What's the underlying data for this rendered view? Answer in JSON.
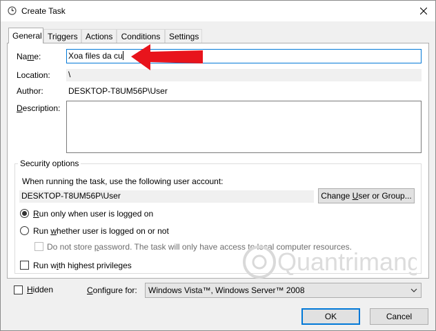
{
  "window": {
    "title": "Create Task"
  },
  "tabs": [
    "General",
    "Triggers",
    "Actions",
    "Conditions",
    "Settings"
  ],
  "fields": {
    "name_label_pre": "Na",
    "name_label_key": "m",
    "name_label_post": "e:",
    "name_value": "Xoa files da cu",
    "location_label": "Location:",
    "location_value": "\\",
    "author_label": "Author:",
    "author_value": "DESKTOP-T8UM56P\\User",
    "description_label_key": "D",
    "description_label_post": "escription:"
  },
  "security": {
    "title": "Security options",
    "account_prompt": "When running the task, use the following user account:",
    "account_value": "DESKTOP-T8UM56P\\User",
    "change_btn_pre": "Change ",
    "change_btn_key": "U",
    "change_btn_post": "ser or Group...",
    "radio_logged_on_key": "R",
    "radio_logged_on_post": "un only when user is logged on",
    "radio_whether_pre": "Run ",
    "radio_whether_key": "w",
    "radio_whether_post": "hether user is logged on or not",
    "no_store_pre": "Do not store ",
    "no_store_key": "p",
    "no_store_post": "assword.  The task will only have access to local computer resources.",
    "highest_pre": "Run w",
    "highest_key": "i",
    "highest_post": "th highest privileges"
  },
  "bottom": {
    "hidden_key": "H",
    "hidden_post": "idden",
    "configure_key": "C",
    "configure_post": "onfigure for:",
    "configure_value": "Windows Vista™, Windows Server™ 2008"
  },
  "buttons": {
    "ok": "OK",
    "cancel": "Cancel"
  },
  "watermark": {
    "text": "Quantrimang"
  },
  "colors": {
    "accent": "#0078d7",
    "arrow": "#e8141c"
  }
}
